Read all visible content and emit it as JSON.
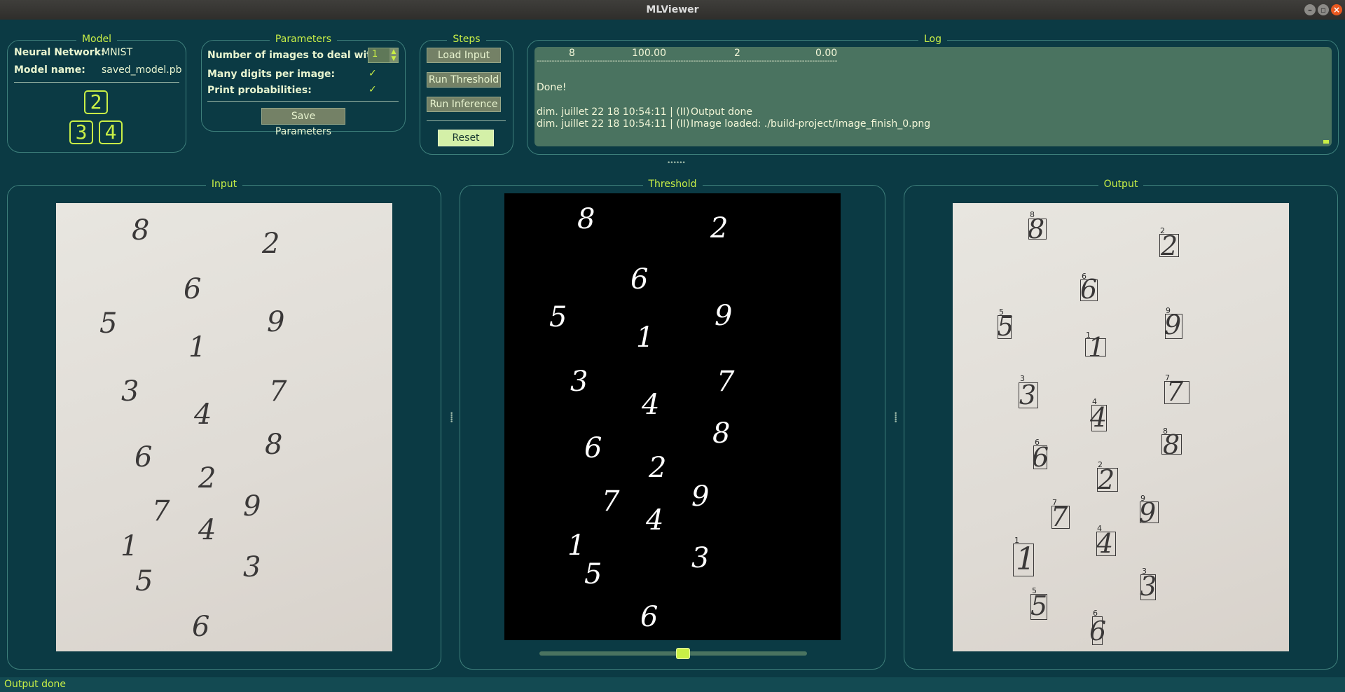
{
  "window": {
    "title": "MLViewer"
  },
  "model": {
    "title": "Model",
    "network_label": "Neural Network:",
    "network_value": "MNIST",
    "name_label": "Model name:",
    "name_value": "saved_model.pb",
    "digits": [
      "2",
      "3",
      "4"
    ]
  },
  "parameters": {
    "title": "Parameters",
    "num_images_label": "Number of images to deal with:",
    "num_images_value": "1",
    "many_digits_label": "Many digits per image:",
    "many_digits_checked": true,
    "print_prob_label": "Print probabilities:",
    "print_prob_checked": true,
    "check_glyph": "✓",
    "save_button": "Save Parameters"
  },
  "steps": {
    "title": "Steps",
    "load_input": "Load Input",
    "run_threshold": "Run Threshold",
    "run_inference": "Run Inference",
    "reset": "Reset"
  },
  "log": {
    "title": "Log",
    "table_row": [
      "8",
      "100.00",
      "2",
      "0.00"
    ],
    "divider": "-----------------------------------------------------------------------------------------------------------------------",
    "done": "Done!",
    "entries": [
      {
        "time": "dim. juillet 22 18 10:54:11 | (II)",
        "message": "Output done"
      },
      {
        "time": "dim. juillet 22 18 10:54:11 | (II)",
        "message": "Image loaded: ./build-project/image_finish_0.png"
      }
    ]
  },
  "panels": {
    "input_title": "Input",
    "threshold_title": "Threshold",
    "output_title": "Output"
  },
  "handwritten_digits": [
    "8",
    "2",
    "6",
    "5",
    "9",
    "1",
    "3",
    "7",
    "4",
    "6",
    "8",
    "2",
    "7",
    "9",
    "4",
    "1",
    "3",
    "5",
    "6"
  ],
  "threshold_slider": {
    "value_fraction": 0.54
  },
  "status": {
    "text": "Output done"
  }
}
